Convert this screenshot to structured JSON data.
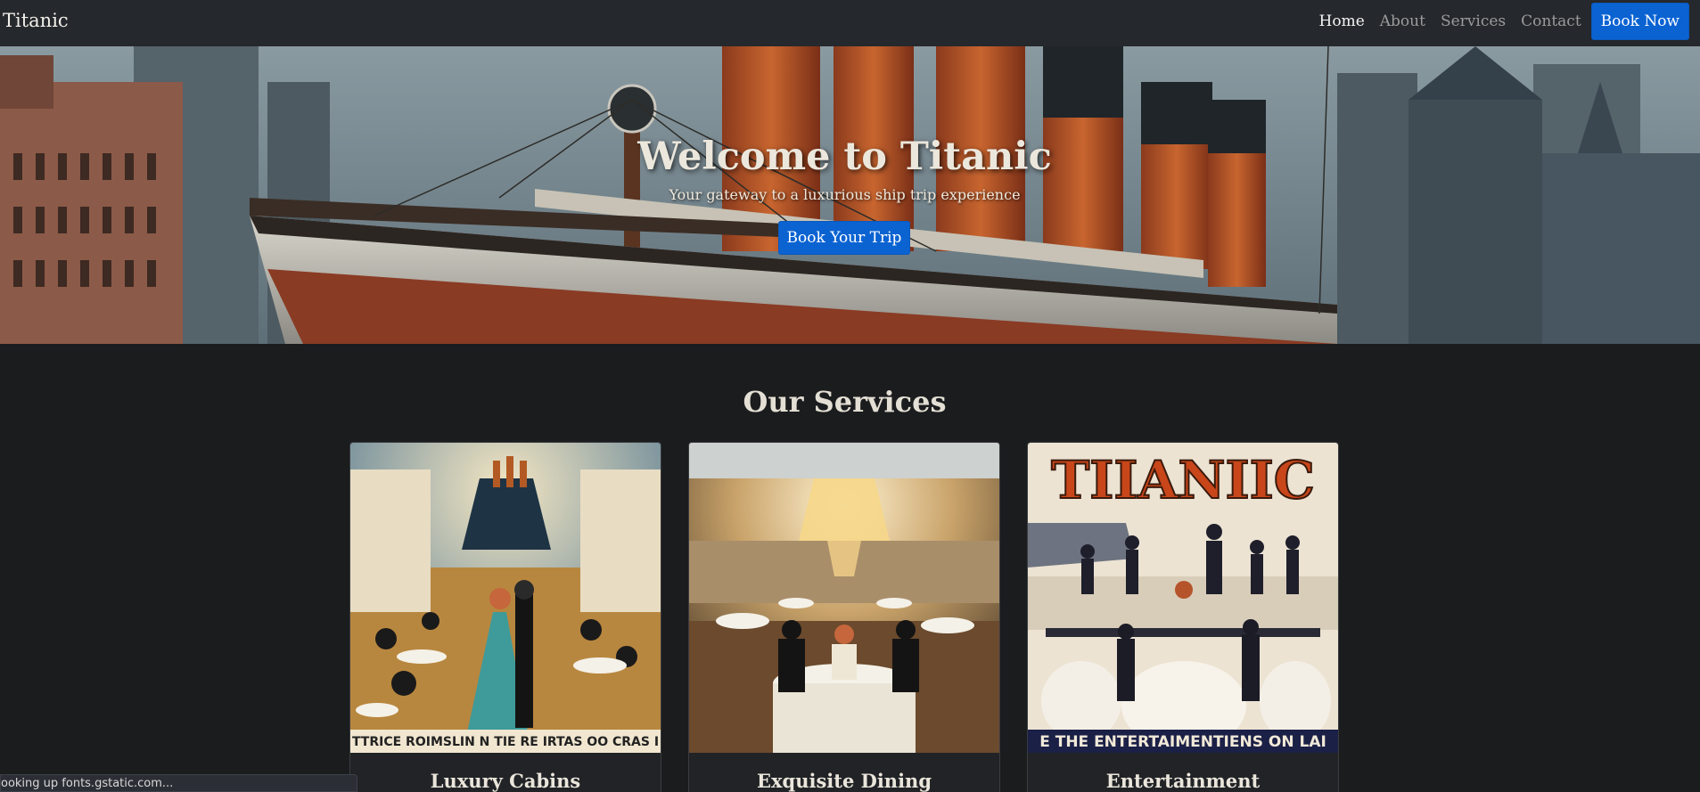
{
  "navbar": {
    "brand": "Titanic",
    "links": [
      {
        "label": "Home",
        "active": true
      },
      {
        "label": "About",
        "active": false
      },
      {
        "label": "Services",
        "active": false
      },
      {
        "label": "Contact",
        "active": false
      }
    ],
    "cta_label": "Book Now"
  },
  "hero": {
    "title": "Welcome to Titanic",
    "subtitle": "Your gateway to a luxurious ship trip experience",
    "button_label": "Book Your Trip"
  },
  "services": {
    "heading": "Our Services",
    "cards": [
      {
        "title": "Luxury Cabins",
        "image_caption": "TTRICE ROIMSLIN N TIE RE IRTAS OO CRAS I"
      },
      {
        "title": "Exquisite Dining"
      },
      {
        "title": "Entertainment",
        "image_banner": "TIIANIIC",
        "image_caption": "E THE ENTERTAIMENTIENS ON LAI"
      }
    ]
  },
  "status_bar": {
    "text": "ooking up fonts.gstatic.com..."
  },
  "colors": {
    "navbar_bg": "#25282c",
    "page_bg": "#1b1c1e",
    "primary_button": "#0b63d2",
    "card_bg": "#212326"
  }
}
